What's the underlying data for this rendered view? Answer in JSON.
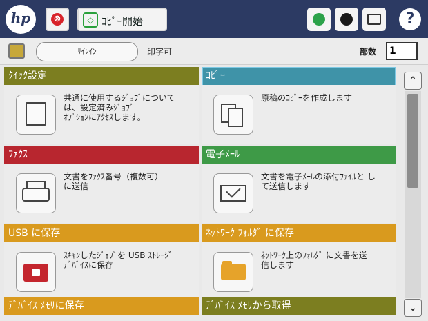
{
  "topbar": {
    "logo_text": "hp",
    "stop_icon_glyph": "⊗",
    "start_icon_glyph": "◇",
    "start_label": "ｺﾋﾟｰ開始",
    "help_glyph": "?",
    "icons": [
      "network-status-icon",
      "sleep-icon",
      "keyboard-icon",
      "help-icon"
    ]
  },
  "subbar": {
    "signin_label": "ｻｲﾝｲﾝ",
    "status_text": "印字可",
    "copies_label": "部数",
    "copies_value": "1"
  },
  "tiles": [
    {
      "title": "ｸｲｯｸ設定",
      "desc": "共通に使用するｼﾞｮﾌﾞについて\nは、設定済みｼﾞｮﾌﾞ\nｵﾌﾟｼｮﾝにｱｸｾｽします。",
      "color": "#7c7e20",
      "icon": "quick-sets-icon"
    },
    {
      "title": "ｺﾋﾟｰ",
      "desc": "原稿のｺﾋﾟｰを作成します",
      "color": "#3f93a8",
      "icon": "copy-icon"
    },
    {
      "title": "ﾌｧｸｽ",
      "desc": "文書をﾌｧｸｽ番号（複数可）\nに送信",
      "color": "#b8262f",
      "icon": "fax-icon"
    },
    {
      "title": "電子ﾒｰﾙ",
      "desc": "文書を電子ﾒｰﾙの添付ﾌｧｲﾙと し\nて送信します",
      "color": "#3e9a47",
      "icon": "email-icon"
    },
    {
      "title": "USB に保存",
      "desc": "ｽｷｬﾝしたｼﾞｮﾌﾞを USB ｽﾄﾚｰｼﾞ\nﾃﾞﾊﾞｲｽに保存",
      "color": "#d99a1e",
      "icon": "usb-save-icon"
    },
    {
      "title": "ﾈｯﾄﾜｰｸ ﾌｫﾙﾀﾞ に保存",
      "desc": "ﾈｯﾄﾜｰｸ上のﾌｫﾙﾀﾞ に文書を送\n信します",
      "color": "#d99a1e",
      "icon": "network-folder-icon"
    },
    {
      "title": "ﾃﾞﾊﾞｲｽ ﾒﾓﾘに保存",
      "desc": "",
      "color": "#d99a1e",
      "icon": "device-memory-save-icon"
    },
    {
      "title": "ﾃﾞﾊﾞｲｽ ﾒﾓﾘから取得",
      "desc": "",
      "color": "#7c7e20",
      "icon": "device-memory-retrieve-icon"
    }
  ],
  "scroll": {
    "up_glyph": "⌃",
    "down_glyph": "⌄"
  }
}
